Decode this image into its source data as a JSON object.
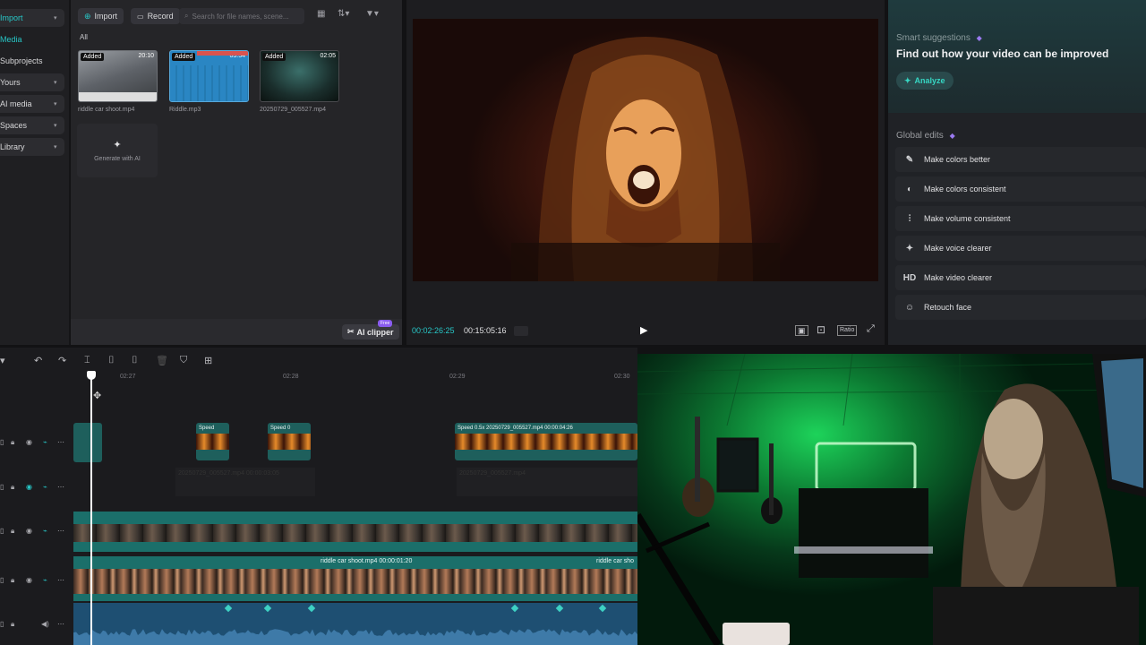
{
  "nav": {
    "items": [
      {
        "label": "Import",
        "chev": "▾"
      },
      {
        "label": "Media",
        "chev": ""
      },
      {
        "label": "Subprojects",
        "chev": ""
      },
      {
        "label": "Yours",
        "chev": "▾"
      },
      {
        "label": "AI media",
        "chev": "▾"
      },
      {
        "label": "Spaces",
        "chev": "▾"
      },
      {
        "label": "Library",
        "chev": "▾"
      }
    ]
  },
  "media": {
    "import_label": "Import",
    "record_label": "Record",
    "search_placeholder": "Search for file names, scene...",
    "filter_label": "All",
    "clips": [
      {
        "badge": "Added",
        "duration": "20:10",
        "name": "riddle car shoot.mp4"
      },
      {
        "badge": "Added",
        "duration": "03:54",
        "name": "Riddle.mp3"
      },
      {
        "badge": "Added",
        "duration": "02:05",
        "name": "20250729_005527.mp4"
      }
    ],
    "generate_label": "Generate with AI",
    "ai_clipper_label": "AI clipper",
    "free_badge": "Free"
  },
  "player": {
    "current_time": "00:02:26:25",
    "total_time": "00:15:05:16",
    "ratio_label": "Ratio"
  },
  "suggestions": {
    "heading": "Smart suggestions",
    "title": "Find out how your video can be improved",
    "analyze_label": "Analyze",
    "global_heading": "Global edits",
    "items": [
      {
        "icon": "✎",
        "label": "Make colors better"
      },
      {
        "icon": "◐",
        "label": "Make colors consistent"
      },
      {
        "icon": "⫶",
        "label": "Make volume consistent"
      },
      {
        "icon": "✦",
        "label": "Make voice clearer"
      },
      {
        "icon": "HD",
        "label": "Make video clearer"
      },
      {
        "icon": "☺",
        "label": "Retouch face"
      }
    ]
  },
  "timeline": {
    "ruler": [
      "02:27",
      "02:28",
      "02:29",
      "02:30"
    ],
    "speed_clips": [
      {
        "label": "Speed"
      },
      {
        "label": "Speed 0"
      },
      {
        "label": "Speed 0.5x   20250729_005527.mp4   00:00:04:26"
      }
    ],
    "ghost_labels": [
      "20250729_005527.mp4  00:00:03:05",
      "20250729_005527.mp4"
    ],
    "main_clip_label": "riddle car shoot.mp4   00:00:01:20",
    "main_clip_label2": "riddle car sho"
  },
  "colors": {
    "accent": "#27c7c7",
    "clip_teal": "#1b6f6a",
    "audio_blue": "#1e4f72"
  }
}
